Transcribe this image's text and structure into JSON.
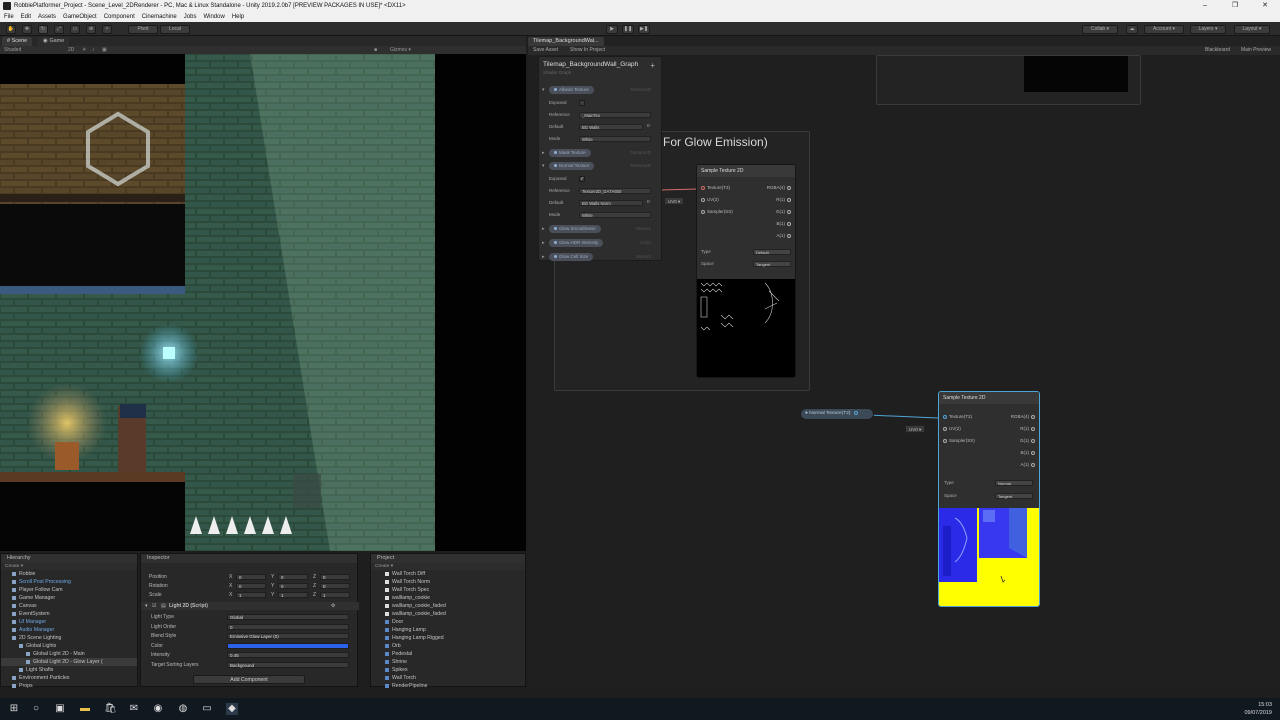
{
  "window": {
    "title": "RobbiePlatformer_Project - Scene_Level_2DRenderer - PC, Mac & Linux Standalone - Unity 2019.2.0b7 [PREVIEW PACKAGES IN USE]* <DX11>",
    "minimize": "–",
    "maximize": "❐",
    "close": "✕"
  },
  "menu": [
    "File",
    "Edit",
    "Assets",
    "GameObject",
    "Component",
    "Cinemachine",
    "Jobs",
    "Window",
    "Help"
  ],
  "toolbar": {
    "pivot": "Pivot",
    "local": "Local",
    "collab": "Collab ▾",
    "account": "Account ▾",
    "layers": "Layers ▾",
    "layout": "Layout ▾"
  },
  "scene_panel": {
    "tabs": [
      "Scene",
      "Game"
    ],
    "shading": "Shaded",
    "mode_2d": "2D",
    "gizmos": "Gizmos ▾"
  },
  "graph_panel": {
    "tab": "Tilemap_BackgroundWal...",
    "save": "Save Asset",
    "show": "Show In Project",
    "blackboard_btn": "Blackboard",
    "preview_btn": "Main Preview",
    "group_title": "For Glow Emission)",
    "blackboard": {
      "title": "Tilemap_BackgroundWall_Graph",
      "subtitle": "Shader Graph",
      "add": "+",
      "props": [
        {
          "name": "Albedo Texture",
          "type": "Texture2D"
        },
        {
          "name": "Mask Texture",
          "type": "Texture2D"
        },
        {
          "name": "Normal Texture",
          "type": "Texture2D"
        },
        {
          "name": "Glow Smoothness",
          "type": "Vector1"
        },
        {
          "name": "Glow HDR Intensity",
          "type": "Color"
        },
        {
          "name": "Glow Cell Size",
          "type": "Vector1"
        }
      ],
      "labels": {
        "exposed": "Exposed",
        "reference": "Reference",
        "default": "Default",
        "mode": "Mode",
        "ref1": "_MainTex",
        "def1": "BG Walls",
        "mode1": "White",
        "ref2": "Texture2D_DA7A650",
        "def2": "BG Walls Norm",
        "mode2": "White",
        "zero": "0"
      }
    },
    "node1": {
      "title": "Sample Texture 2D",
      "inputs": [
        "Texture(T2)",
        "UV(2)",
        "Sampler(SS)"
      ],
      "outputs": [
        "RGBA(4)",
        "R(1)",
        "G(1)",
        "B(1)",
        "A(1)"
      ],
      "type_label": "Type",
      "type_value": "Default",
      "space_label": "Space",
      "space_value": "Tangent"
    },
    "node2": {
      "title": "Sample Texture 2D",
      "inputs": [
        "Texture(T2)",
        "UV(2)",
        "Sampler(SS)"
      ],
      "outputs": [
        "RGBA(4)",
        "R(1)",
        "G(1)",
        "B(1)",
        "A(1)"
      ],
      "type_label": "Type",
      "type_value": "Normal",
      "space_label": "Space",
      "space_value": "Tangent"
    },
    "uv_chip": "UV0 ▾",
    "property_node": "Normal Texture(T2)"
  },
  "hierarchy": {
    "title": "Hierarchy",
    "create": "Create ▾",
    "items": [
      {
        "label": "Robbie",
        "indent": 1,
        "style": ""
      },
      {
        "label": "Scroll Post Processing",
        "indent": 1,
        "style": "blue"
      },
      {
        "label": "Player Follow Cam",
        "indent": 1,
        "style": ""
      },
      {
        "label": "Game Manager",
        "indent": 1,
        "style": ""
      },
      {
        "label": "Canvas",
        "indent": 1,
        "style": ""
      },
      {
        "label": "EventSystem",
        "indent": 1,
        "style": ""
      },
      {
        "label": "UI Manager",
        "indent": 1,
        "style": "blue"
      },
      {
        "label": "Audio Manager",
        "indent": 1,
        "style": "blue"
      },
      {
        "label": "2D Scene Lighting",
        "indent": 1,
        "style": ""
      },
      {
        "label": "Global Lights",
        "indent": 2,
        "style": ""
      },
      {
        "label": "Global Light 2D - Main",
        "indent": 3,
        "style": ""
      },
      {
        "label": "Global Light 2D - Glow Layer (",
        "indent": 3,
        "style": "sel"
      },
      {
        "label": "Light Shafts",
        "indent": 2,
        "style": ""
      },
      {
        "label": "Environment Particles",
        "indent": 1,
        "style": ""
      },
      {
        "label": "Props",
        "indent": 1,
        "style": ""
      }
    ]
  },
  "inspector": {
    "title": "Inspector",
    "position": "Position",
    "rotation": "Rotation",
    "scale": "Scale",
    "x": "X",
    "y": "Y",
    "z": "Z",
    "pos": [
      "0",
      "0",
      "0"
    ],
    "rot": [
      "0",
      "0",
      "0"
    ],
    "scl": [
      "1",
      "1",
      "1"
    ],
    "component": "Light 2D (Script)",
    "fields": [
      {
        "label": "Light Type",
        "value": "Global"
      },
      {
        "label": "Light Order",
        "value": "0"
      },
      {
        "label": "Blend Style",
        "value": "Emissive Glow Layer (0)"
      },
      {
        "label": "Color",
        "value": ""
      },
      {
        "label": "Intensity",
        "value": "0.45"
      },
      {
        "label": "Target Sorting Layers",
        "value": "Background"
      }
    ],
    "add_component": "Add Component",
    "color_value": "#2c62e8"
  },
  "project": {
    "title": "Project",
    "create": "Create ▾",
    "items": [
      "Wall Torch Diff",
      "Wall Torch Norm",
      "Wall Torch Spec",
      "walllamp_cookie",
      "walllamp_cookie_faded",
      "walllamp_cookie_faded",
      "Door",
      "Hanging Lamp",
      "Hanging Lamp Rigged",
      "Orb",
      "Pedestal",
      "Shrine",
      "Spikes",
      "Wall Torch",
      "RenderPipeline"
    ]
  },
  "taskbar": {
    "time": "15:03",
    "date": "09/07/2019"
  },
  "colors": {
    "accent": "#4ea6d8",
    "preview_yellow": "#ffff00",
    "normal_blue": "#2a2ae8"
  }
}
